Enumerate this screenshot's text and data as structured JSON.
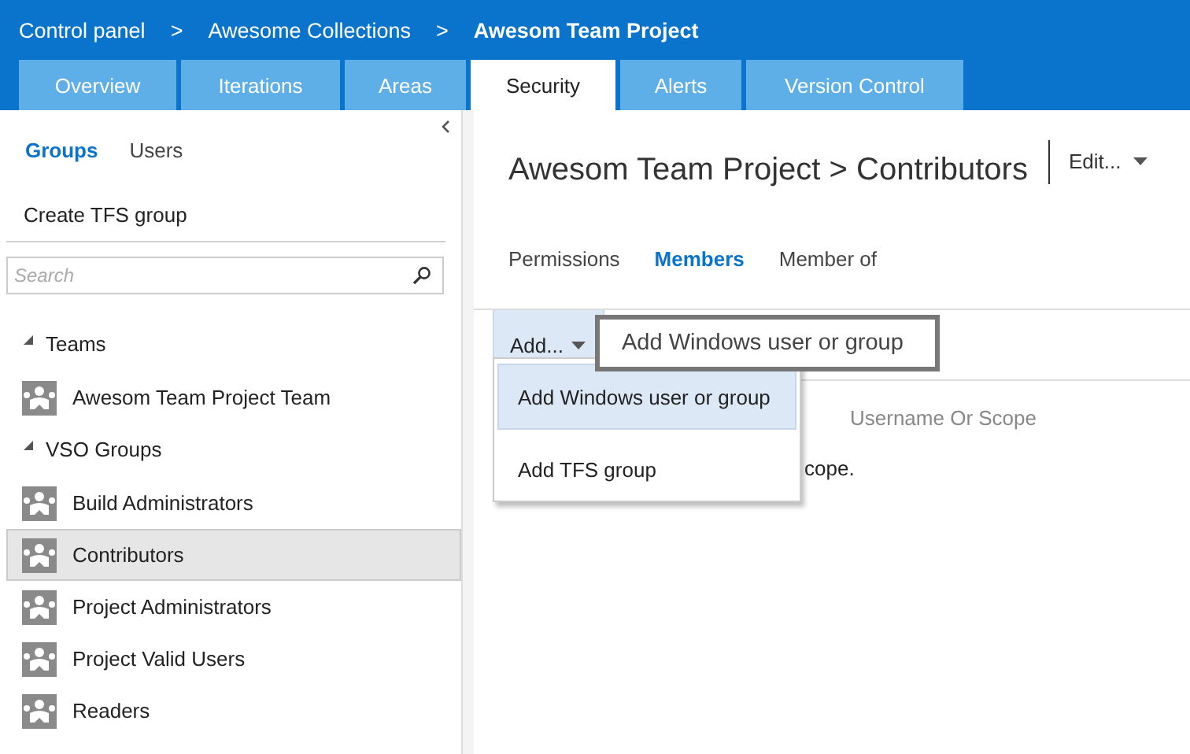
{
  "breadcrumb": [
    {
      "label": "Control panel",
      "current": false,
      "separator": ">"
    },
    {
      "label": "Awesome Collections",
      "current": false,
      "separator": ">"
    },
    {
      "label": "Awesom Team Project",
      "current": true
    }
  ],
  "tabs": [
    {
      "label": "Overview",
      "selected": false
    },
    {
      "label": "Iterations",
      "selected": false
    },
    {
      "label": "Areas",
      "selected": false
    },
    {
      "label": "Security",
      "selected": true
    },
    {
      "label": "Alerts",
      "selected": false
    },
    {
      "label": "Version Control",
      "selected": false
    }
  ],
  "sidebar": {
    "views": [
      {
        "label": "Groups",
        "selected": true
      },
      {
        "label": "Users",
        "selected": false
      }
    ],
    "create_link": "Create TFS group",
    "search": {
      "placeholder": "Search"
    },
    "tree": [
      {
        "label": "Teams",
        "expanded": true,
        "children": [
          {
            "label": "Awesom Team Project Team",
            "selected": false
          }
        ]
      },
      {
        "label": "VSO Groups",
        "expanded": true,
        "children": [
          {
            "label": "Build Administrators",
            "selected": false
          },
          {
            "label": "Contributors",
            "selected": true
          },
          {
            "label": "Project Administrators",
            "selected": false
          },
          {
            "label": "Project Valid Users",
            "selected": false
          },
          {
            "label": "Readers",
            "selected": false
          }
        ]
      }
    ]
  },
  "main": {
    "title": "Awesom Team Project > Contributors",
    "edit_menu": "Edit...",
    "subtabs": [
      {
        "label": "Permissions",
        "selected": false
      },
      {
        "label": "Members",
        "selected": true
      },
      {
        "label": "Member of",
        "selected": false
      }
    ],
    "add_button": {
      "label": "Add...",
      "expanded": true
    },
    "add_menu": [
      {
        "label": "Add Windows user or group",
        "selected": true
      },
      {
        "label": "Add TFS group",
        "selected": false
      }
    ],
    "tooltip": "Add Windows user or group",
    "column_header": "Username Or Scope",
    "message": "cope."
  }
}
